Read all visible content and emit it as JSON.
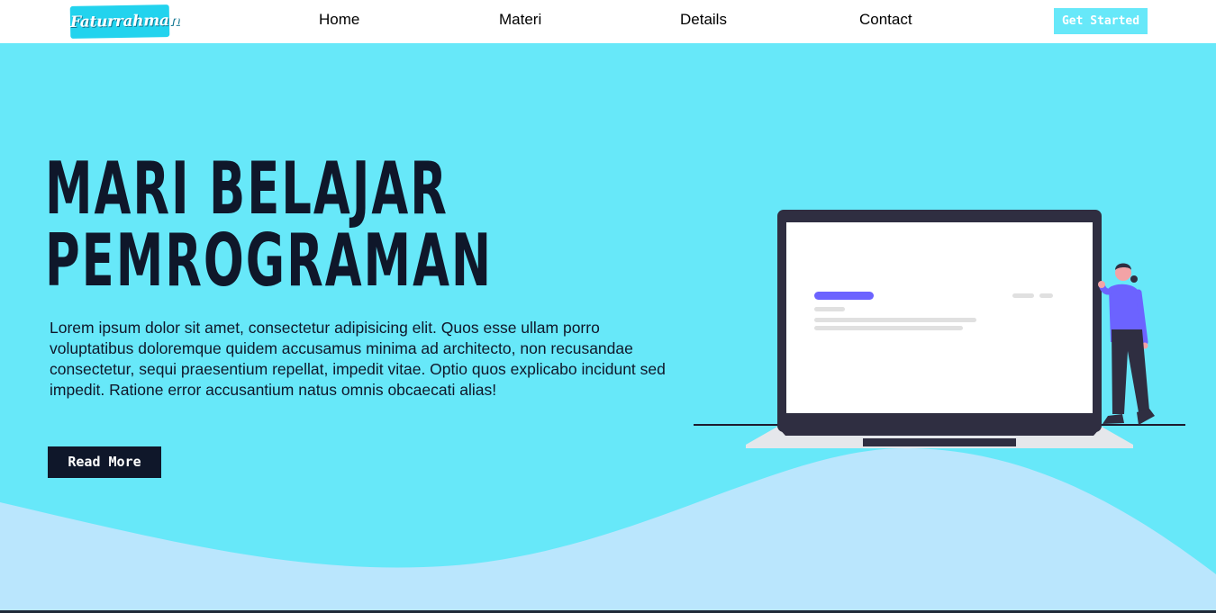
{
  "brand": {
    "logo_text": "Faturrahman"
  },
  "nav": {
    "links": [
      "Home",
      "Materi",
      "Details",
      "Contact"
    ],
    "cta_label": "Get Started"
  },
  "hero": {
    "title_line1": "MARI BELAJAR",
    "title_line2": "PEMROGRAMAN",
    "paragraph": "Lorem ipsum dolor sit amet, consectetur adipisicing elit. Quos esse ullam porro voluptatibus doloremque quidem accusamus minima ad architecto, non recusandae consectetur, sequi praesentium repellat, impedit vitae. Optio quos explicabo incidunt sed impedit. Ratione error accusantium natus omnis obcaecati alias!",
    "button_label": "Read More"
  },
  "colors": {
    "background": "#67e8f9",
    "wave": "#bae6fd",
    "dark": "#0f172a",
    "logo_bg": "#22d3ee",
    "accent_purple": "#6c63ff"
  },
  "illustration": {
    "icon": "laptop-person-illustration"
  }
}
